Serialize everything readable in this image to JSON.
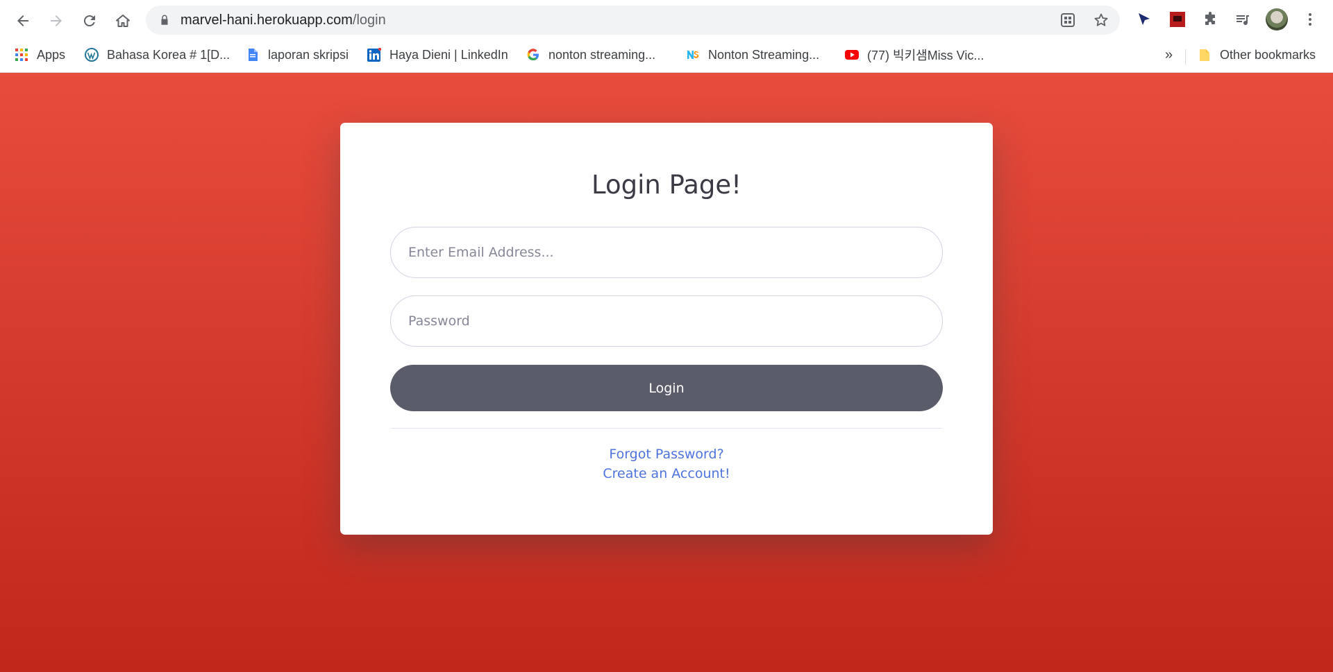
{
  "browser": {
    "url_domain": "marvel-hani.herokuapp.com",
    "url_path": "/login",
    "icons": {
      "back": "back-arrow-icon",
      "forward": "forward-arrow-icon",
      "reload": "reload-icon",
      "home": "home-icon",
      "lock": "lock-icon",
      "install": "install-app-icon",
      "star": "bookmark-star-icon",
      "extensions": "puzzle-icon",
      "media": "media-queue-icon",
      "menu": "kebab-menu-icon"
    }
  },
  "bookmarks": {
    "items": [
      {
        "label": "Apps",
        "icon": "apps-grid-icon"
      },
      {
        "label": "Bahasa Korea # 1[D...",
        "icon": "wordpress-icon"
      },
      {
        "label": "laporan skripsi",
        "icon": "document-icon"
      },
      {
        "label": "Haya Dieni | LinkedIn",
        "icon": "linkedin-icon"
      },
      {
        "label": "nonton streaming...",
        "icon": "google-icon"
      },
      {
        "label": "Nonton Streaming...",
        "icon": "ns-icon"
      },
      {
        "label": "(77) 빅키샘Miss Vic...",
        "icon": "youtube-icon"
      }
    ],
    "overflow": "»",
    "other": "Other bookmarks"
  },
  "login": {
    "title": "Login Page!",
    "email_placeholder": "Enter Email Address...",
    "password_placeholder": "Password",
    "button_label": "Login",
    "forgot_label": "Forgot Password?",
    "create_label": "Create an Account!"
  },
  "colors": {
    "background_top": "#e74c3c",
    "background_bottom": "#c0281c",
    "button": "#5a5c69",
    "link": "#4e73df"
  }
}
